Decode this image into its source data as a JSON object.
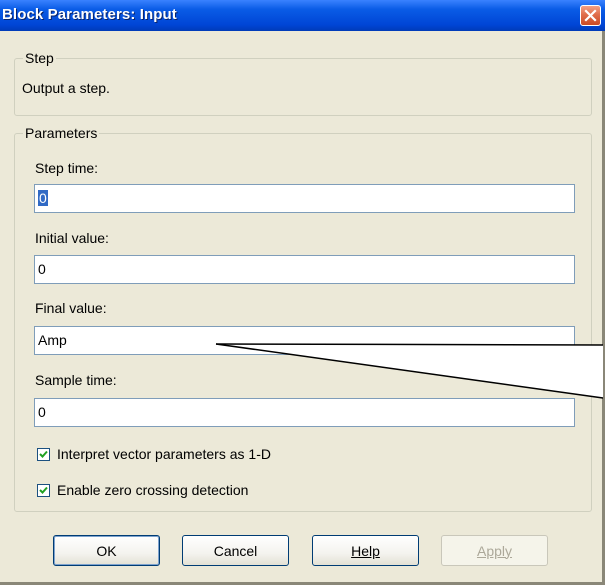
{
  "window": {
    "title": "Block Parameters: Input",
    "close_icon": "close-icon"
  },
  "step_group": {
    "legend": "Step",
    "description": "Output a step."
  },
  "parameters_group": {
    "legend": "Parameters",
    "fields": [
      {
        "label": "Step time:",
        "value": "0",
        "selected": true
      },
      {
        "label": "Initial value:",
        "value": "0",
        "selected": false
      },
      {
        "label": "Final value:",
        "value": "Amp",
        "selected": false
      },
      {
        "label": "Sample time:",
        "value": "0",
        "selected": false
      }
    ],
    "checkboxes": [
      {
        "label": "Interpret vector parameters as 1-D",
        "checked": true
      },
      {
        "label": "Enable zero crossing detection",
        "checked": true
      }
    ]
  },
  "buttons": {
    "ok": "OK",
    "cancel": "Cancel",
    "help": "Help",
    "apply": "Apply"
  },
  "colors": {
    "titlebar": "#0a5ce6",
    "dialog_bg": "#ece9d8",
    "selection": "#316ac5",
    "close_button": "#e06e4c"
  }
}
